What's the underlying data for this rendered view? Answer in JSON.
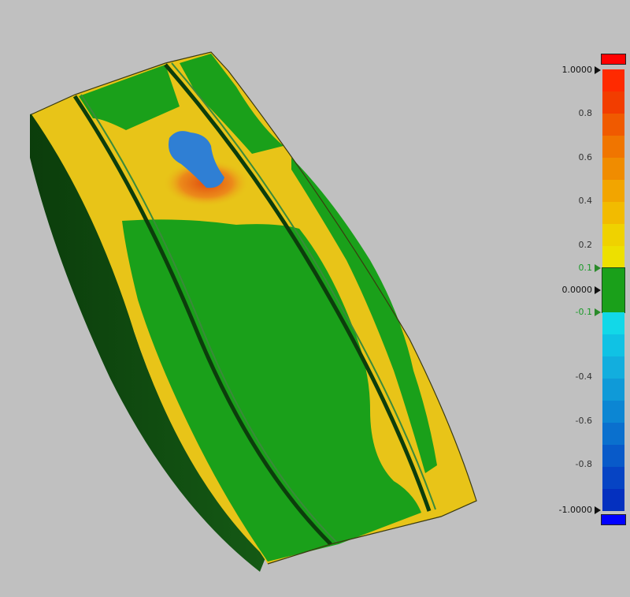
{
  "legend": {
    "top_value": "1.0000",
    "ticks": [
      "0.8",
      "0.6",
      "0.4",
      "0.2"
    ],
    "upper_tolerance": "0.1",
    "nominal": "0.0000",
    "lower_tolerance": "-0.1",
    "neg_ticks": [
      "-0.4",
      "-0.6",
      "-0.8"
    ],
    "bottom_value": "-1.0000",
    "colors": {
      "over_max": "#ff0000",
      "under_min": "#0000ff",
      "in_tolerance": "#1aa01a",
      "positive_bands": [
        "#ff2a00",
        "#f23d00",
        "#f05a00",
        "#f07500",
        "#f08c00",
        "#f2a500",
        "#f2bb00",
        "#efd200",
        "#ede000"
      ],
      "negative_bands": [
        "#12d8e8",
        "#10c2e4",
        "#12aede",
        "#0f9ad8",
        "#0c86d3",
        "#0a70ce",
        "#085ac9",
        "#0644c4",
        "#0430bf"
      ]
    }
  },
  "model": {
    "description_colors": {
      "background": "#c0c0c0",
      "dark_side": "#0f4a0f",
      "green": "#1aa01a",
      "yellow": "#e8c418",
      "orange": "#e8731a",
      "blue": "#2f7fd4"
    }
  }
}
